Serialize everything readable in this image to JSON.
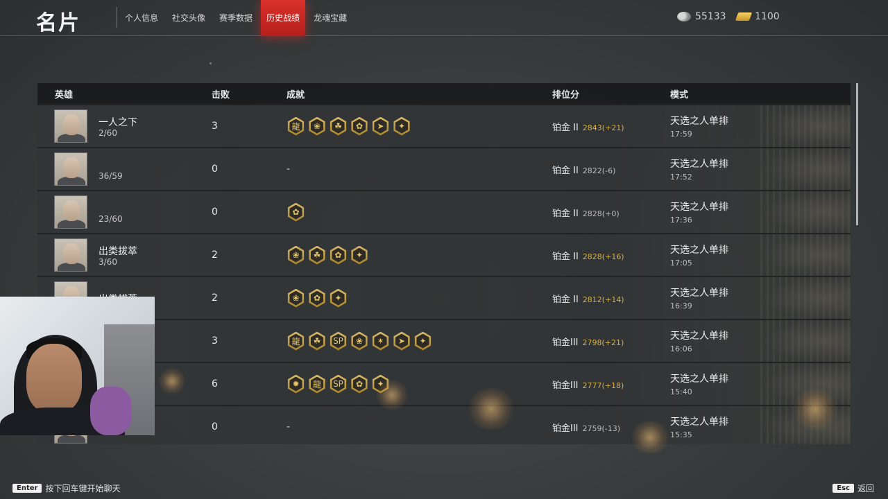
{
  "header": {
    "title": "名片",
    "tabs": [
      {
        "label": "个人信息",
        "active": false
      },
      {
        "label": "社交头像",
        "active": false
      },
      {
        "label": "赛季数据",
        "active": false
      },
      {
        "label": "历史战绩",
        "active": true
      },
      {
        "label": "龙魂宝藏",
        "active": false
      }
    ],
    "currency": {
      "coins": "55133",
      "gold": "1100"
    }
  },
  "table": {
    "headers": {
      "hero": "英雄",
      "kills": "击败",
      "achievements": "成就",
      "rank": "排位分",
      "mode": "模式"
    },
    "rows": [
      {
        "hero_name": "一人之下",
        "placement": "2/60",
        "kills": "3",
        "achievements": [
          "龍",
          "❀",
          "☘",
          "✿",
          "➤",
          "✦"
        ],
        "rank_tier": "铂金 II",
        "rank_score": "2843(+21)",
        "score_up": true,
        "mode": "天选之人单排",
        "time": "17:59"
      },
      {
        "hero_name": "",
        "placement": "36/59",
        "kills": "0",
        "achievements": [],
        "rank_tier": "铂金 II",
        "rank_score": "2822(-6)",
        "score_up": false,
        "mode": "天选之人单排",
        "time": "17:52"
      },
      {
        "hero_name": "",
        "placement": "23/60",
        "kills": "0",
        "achievements": [
          "✿"
        ],
        "rank_tier": "铂金 II",
        "rank_score": "2828(+0)",
        "score_up": false,
        "mode": "天选之人单排",
        "time": "17:36"
      },
      {
        "hero_name": "出类拔萃",
        "placement": "3/60",
        "kills": "2",
        "achievements": [
          "❀",
          "☘",
          "✿",
          "✦"
        ],
        "rank_tier": "铂金 II",
        "rank_score": "2828(+16)",
        "score_up": true,
        "mode": "天选之人单排",
        "time": "17:05"
      },
      {
        "hero_name": "出类拔萃",
        "placement": "",
        "kills": "2",
        "achievements": [
          "❀",
          "✿",
          "✦"
        ],
        "rank_tier": "铂金 II",
        "rank_score": "2812(+14)",
        "score_up": true,
        "mode": "天选之人单排",
        "time": "16:39"
      },
      {
        "hero_name": "",
        "placement": "",
        "kills": "3",
        "achievements": [
          "龍",
          "☘",
          "SP",
          "❀",
          "✶",
          "➤",
          "✦"
        ],
        "rank_tier": "铂金III",
        "rank_score": "2798(+21)",
        "score_up": true,
        "mode": "天选之人单排",
        "time": "16:06"
      },
      {
        "hero_name": "",
        "placement": "",
        "kills": "6",
        "achievements": [
          "✹",
          "龍",
          "SP",
          "✿",
          "✦"
        ],
        "rank_tier": "铂金III",
        "rank_score": "2777(+18)",
        "score_up": true,
        "mode": "天选之人单排",
        "time": "15:40"
      },
      {
        "hero_name": "",
        "placement": "",
        "kills": "0",
        "achievements": [],
        "rank_tier": "铂金III",
        "rank_score": "2759(-13)",
        "score_up": false,
        "mode": "天选之人单排",
        "time": "15:35"
      }
    ],
    "empty_achievement": "-"
  },
  "footer": {
    "enter_key": "Enter",
    "enter_hint": "按下回车键开始聊天",
    "esc_key": "Esc",
    "esc_hint": "返回"
  },
  "colors": {
    "active_tab": "#c8241f",
    "score_up": "#d4b04a",
    "score_neutral": "#bdbdbd",
    "badge_gold": "#d9b865"
  }
}
